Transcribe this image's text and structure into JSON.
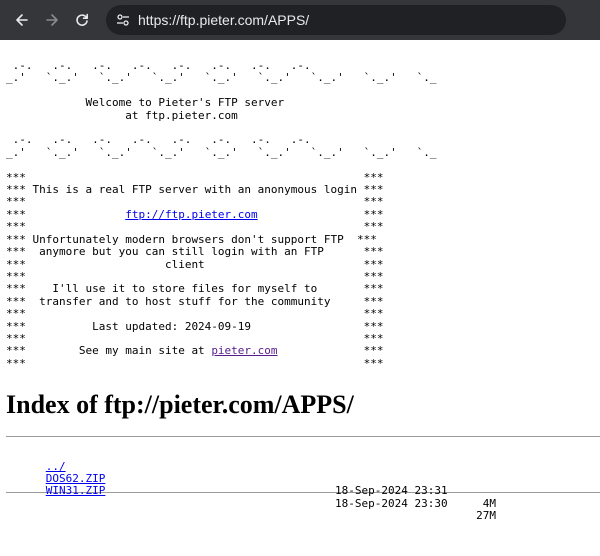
{
  "browser": {
    "url": "https://ftp.pieter.com/APPS/"
  },
  "banner": {
    "wave_top_1": " .-.   .-.   .-.   .-.   .-.   .-.   .-.   .-.",
    "wave_top_2": "_.'   `._.'   `._.'   `._.'   `._.'   `._.'   `._.'   `._.'   `._",
    "welcome_1": "            Welcome to Pieter's FTP server",
    "welcome_2": "                  at ftp.pieter.com",
    "wave_bottom_1": " .-.   .-.   .-.   .-.   .-.   .-.   .-.   .-.",
    "wave_bottom_2": "_.'   `._.'   `._.'   `._.'   `._.'   `._.'   `._.'   `._.'   `._",
    "stars": "***",
    "line_real": " This is a real FTP server with an anonymous login ",
    "ftp_link": "ftp://ftp.pieter.com",
    "line_unfortunately": " Unfortunately modern browsers don't support FTP  ",
    "line_anymore": "  anymore but you can still login with an FTP    ",
    "line_client": "                     client                      ",
    "line_use_it": "    I'll use it to store files for myself to     ",
    "line_transfer": "  transfer and to host stuff for the community   ",
    "line_updated": "          Last updated: 2024-09-19               ",
    "main_site_prefix": "        See my main site at ",
    "main_site_link": "pieter.com"
  },
  "index": {
    "heading": "Index of ftp://pieter.com/APPS/",
    "parent_link": "../",
    "files": [
      {
        "name": "DOS62.ZIP",
        "date": "18-Sep-2024 23:31",
        "size": "4M"
      },
      {
        "name": "WIN31.ZIP",
        "date": "18-Sep-2024 23:30",
        "size": "27M"
      }
    ]
  }
}
